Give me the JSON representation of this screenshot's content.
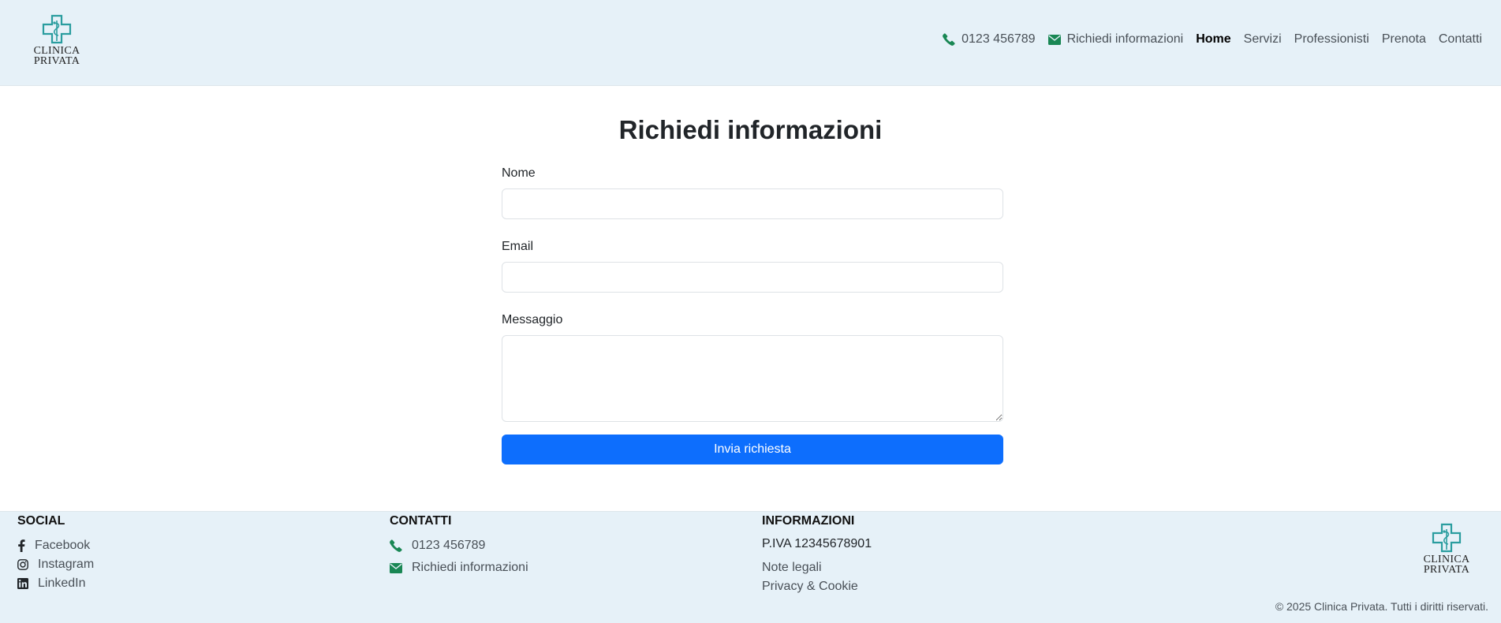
{
  "brand": {
    "logo_line1": "CLINICA",
    "logo_line2": "PRIVATA",
    "accent_color": "#2a9d9f"
  },
  "header": {
    "phone": "0123 456789",
    "info_link": "Richiedi informazioni",
    "nav": [
      {
        "label": "Home",
        "active": true
      },
      {
        "label": "Servizi",
        "active": false
      },
      {
        "label": "Professionisti",
        "active": false
      },
      {
        "label": "Prenota",
        "active": false
      },
      {
        "label": "Contatti",
        "active": false
      }
    ]
  },
  "form": {
    "title": "Richiedi informazioni",
    "name_label": "Nome",
    "name_value": "",
    "email_label": "Email",
    "email_value": "",
    "message_label": "Messaggio",
    "message_value": "",
    "submit_label": "Invia richiesta",
    "button_color": "#0d6efd"
  },
  "footer": {
    "social": {
      "heading": "SOCIAL",
      "items": [
        "Facebook",
        "Instagram",
        "LinkedIn"
      ]
    },
    "contacts": {
      "heading": "CONTATTI",
      "phone": "0123 456789",
      "info": "Richiedi informazioni"
    },
    "info": {
      "heading": "INFORMAZIONI",
      "vat": "P.IVA 12345678901",
      "legal": "Note legali",
      "privacy": "Privacy & Cookie"
    },
    "copyright": "© 2025 Clinica Privata. Tutti i diritti riservati."
  },
  "icons": {
    "phone": "phone-icon",
    "email": "envelope-icon",
    "facebook": "facebook-icon",
    "instagram": "instagram-icon",
    "linkedin": "linkedin-icon",
    "icon_green": "#198754"
  }
}
